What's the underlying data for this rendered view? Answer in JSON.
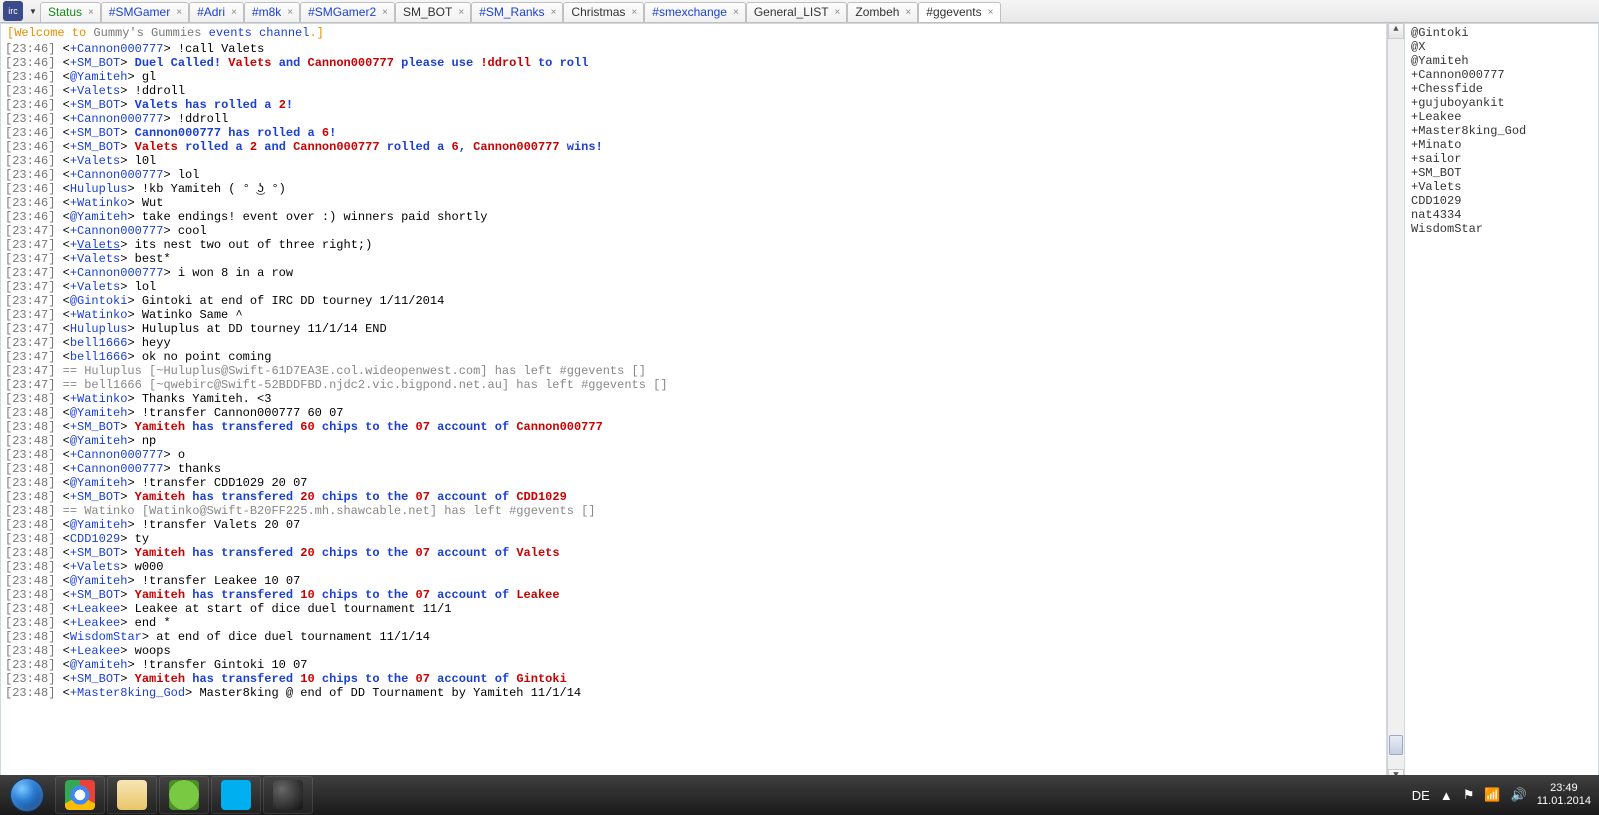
{
  "tabs": [
    {
      "label": "Status",
      "color": "green",
      "close": true
    },
    {
      "label": "#SMGamer",
      "color": "blue",
      "close": true
    },
    {
      "label": "#Adri",
      "color": "blue",
      "close": true
    },
    {
      "label": "#m8k",
      "color": "blue",
      "close": true
    },
    {
      "label": "#SMGamer2",
      "color": "blue",
      "close": true
    },
    {
      "label": "SM_BOT",
      "color": "",
      "close": true
    },
    {
      "label": "#SM_Ranks",
      "color": "blue",
      "close": true
    },
    {
      "label": "Christmas",
      "color": "",
      "close": true
    },
    {
      "label": "#smexchange",
      "color": "blue",
      "close": true
    },
    {
      "label": "General_LIST",
      "color": "",
      "close": true
    },
    {
      "label": "Zombeh",
      "color": "",
      "close": true
    },
    {
      "label": "#ggevents",
      "color": "",
      "close": true,
      "active": true
    }
  ],
  "topic": {
    "welcome": "[Welcome to ",
    "name": "Gummy's Gummies ",
    "events": "events channel",
    "end": ".]"
  },
  "chat": [
    {
      "ts": "[23:46]",
      "parts": [
        {
          "t": " <",
          "c": "txt"
        },
        {
          "t": "+Cannon000777",
          "c": "nick"
        },
        {
          "t": "> !call Valets",
          "c": "txt"
        }
      ]
    },
    {
      "ts": "[23:46]",
      "parts": [
        {
          "t": " <",
          "c": "txt"
        },
        {
          "t": "+SM_BOT",
          "c": "nick"
        },
        {
          "t": "> ",
          "c": "txt"
        },
        {
          "t": "Duel Called! ",
          "c": "blueb"
        },
        {
          "t": "Valets",
          "c": "redb"
        },
        {
          "t": " and ",
          "c": "blueb"
        },
        {
          "t": "Cannon000777",
          "c": "redb"
        },
        {
          "t": " please use ",
          "c": "blueb"
        },
        {
          "t": "!ddroll",
          "c": "redb"
        },
        {
          "t": " to roll",
          "c": "blueb"
        }
      ]
    },
    {
      "ts": "[23:46]",
      "parts": [
        {
          "t": " <",
          "c": "txt"
        },
        {
          "t": "@Yamiteh",
          "c": "nick"
        },
        {
          "t": "> gl",
          "c": "txt"
        }
      ]
    },
    {
      "ts": "[23:46]",
      "parts": [
        {
          "t": " <",
          "c": "txt"
        },
        {
          "t": "+Valets",
          "c": "nick"
        },
        {
          "t": "> !ddroll",
          "c": "txt"
        }
      ]
    },
    {
      "ts": "[23:46]",
      "parts": [
        {
          "t": " <",
          "c": "txt"
        },
        {
          "t": "+SM_BOT",
          "c": "nick"
        },
        {
          "t": "> ",
          "c": "txt"
        },
        {
          "t": "Valets has rolled a ",
          "c": "blueb"
        },
        {
          "t": "2",
          "c": "redb"
        },
        {
          "t": "!",
          "c": "blueb"
        }
      ]
    },
    {
      "ts": "[23:46]",
      "parts": [
        {
          "t": " <",
          "c": "txt"
        },
        {
          "t": "+Cannon000777",
          "c": "nick"
        },
        {
          "t": "> !ddroll",
          "c": "txt"
        }
      ]
    },
    {
      "ts": "[23:46]",
      "parts": [
        {
          "t": " <",
          "c": "txt"
        },
        {
          "t": "+SM_BOT",
          "c": "nick"
        },
        {
          "t": "> ",
          "c": "txt"
        },
        {
          "t": "Cannon000777 has rolled a ",
          "c": "blueb"
        },
        {
          "t": "6",
          "c": "redb"
        },
        {
          "t": "!",
          "c": "blueb"
        }
      ]
    },
    {
      "ts": "[23:46]",
      "parts": [
        {
          "t": " <",
          "c": "txt"
        },
        {
          "t": "+SM_BOT",
          "c": "nick"
        },
        {
          "t": "> ",
          "c": "txt"
        },
        {
          "t": "Valets",
          "c": "redb"
        },
        {
          "t": " rolled a ",
          "c": "blueb"
        },
        {
          "t": "2",
          "c": "redb"
        },
        {
          "t": " and ",
          "c": "blueb"
        },
        {
          "t": "Cannon000777",
          "c": "redb"
        },
        {
          "t": " rolled a ",
          "c": "blueb"
        },
        {
          "t": "6",
          "c": "redb"
        },
        {
          "t": ", ",
          "c": "blueb"
        },
        {
          "t": "Cannon000777",
          "c": "redb"
        },
        {
          "t": " wins!",
          "c": "blueb"
        }
      ]
    },
    {
      "ts": "[23:46]",
      "parts": [
        {
          "t": " <",
          "c": "txt"
        },
        {
          "t": "+Valets",
          "c": "nick"
        },
        {
          "t": "> l0l",
          "c": "txt"
        }
      ]
    },
    {
      "ts": "[23:46]",
      "parts": [
        {
          "t": " <",
          "c": "txt"
        },
        {
          "t": "+Cannon000777",
          "c": "nick"
        },
        {
          "t": "> lol",
          "c": "txt"
        }
      ]
    },
    {
      "ts": "[23:46]",
      "parts": [
        {
          "t": " <",
          "c": "txt"
        },
        {
          "t": "Huluplus",
          "c": "nick"
        },
        {
          "t": "> !kb Yamiteh ( ° ͜ʖ °)",
          "c": "txt"
        }
      ]
    },
    {
      "ts": "[23:46]",
      "parts": [
        {
          "t": " <",
          "c": "txt"
        },
        {
          "t": "+Watinko",
          "c": "nick"
        },
        {
          "t": "> Wut",
          "c": "txt"
        }
      ]
    },
    {
      "ts": "[23:46]",
      "parts": [
        {
          "t": " <",
          "c": "txt"
        },
        {
          "t": "@Yamiteh",
          "c": "nick"
        },
        {
          "t": "> take endings! event over :) winners paid shortly",
          "c": "txt"
        }
      ]
    },
    {
      "ts": "[23:47]",
      "parts": [
        {
          "t": " <",
          "c": "txt"
        },
        {
          "t": "+Cannon000777",
          "c": "nick"
        },
        {
          "t": "> cool",
          "c": "txt"
        }
      ]
    },
    {
      "ts": "[23:47]",
      "parts": [
        {
          "t": " <",
          "c": "txt"
        },
        {
          "t": "+",
          "c": "nick"
        },
        {
          "t": "Valets",
          "c": "nick und"
        },
        {
          "t": "> its nest two out of three right;)",
          "c": "txt"
        }
      ]
    },
    {
      "ts": "[23:47]",
      "parts": [
        {
          "t": " <",
          "c": "txt"
        },
        {
          "t": "+Valets",
          "c": "nick"
        },
        {
          "t": "> best*",
          "c": "txt"
        }
      ]
    },
    {
      "ts": "[23:47]",
      "parts": [
        {
          "t": " <",
          "c": "txt"
        },
        {
          "t": "+Cannon000777",
          "c": "nick"
        },
        {
          "t": "> i won 8 in a row",
          "c": "txt"
        }
      ]
    },
    {
      "ts": "[23:47]",
      "parts": [
        {
          "t": " <",
          "c": "txt"
        },
        {
          "t": "+Valets",
          "c": "nick"
        },
        {
          "t": "> lol",
          "c": "txt"
        }
      ]
    },
    {
      "ts": "[23:47]",
      "parts": [
        {
          "t": " <",
          "c": "txt"
        },
        {
          "t": "@Gintoki",
          "c": "nick"
        },
        {
          "t": "> Gintoki at end of IRC DD tourney 1/11/2014",
          "c": "txt"
        }
      ]
    },
    {
      "ts": "[23:47]",
      "parts": [
        {
          "t": " <",
          "c": "txt"
        },
        {
          "t": "+Watinko",
          "c": "nick"
        },
        {
          "t": "> Watinko Same ^",
          "c": "txt"
        }
      ]
    },
    {
      "ts": "[23:47]",
      "parts": [
        {
          "t": " <",
          "c": "txt"
        },
        {
          "t": "Huluplus",
          "c": "nick"
        },
        {
          "t": "> Huluplus at DD tourney 11/1/14 END",
          "c": "txt"
        }
      ]
    },
    {
      "ts": "[23:47]",
      "parts": [
        {
          "t": " <",
          "c": "txt"
        },
        {
          "t": "bell1666",
          "c": "nick"
        },
        {
          "t": "> heyy",
          "c": "txt"
        }
      ]
    },
    {
      "ts": "[23:47]",
      "parts": [
        {
          "t": " <",
          "c": "txt"
        },
        {
          "t": "bell1666",
          "c": "nick"
        },
        {
          "t": "> ok no point coming",
          "c": "txt"
        }
      ]
    },
    {
      "ts": "[23:47]",
      "parts": [
        {
          "t": " == Huluplus [~Huluplus@Swift-61D7EA3E.col.wideopenwest.com] has left #ggevents []",
          "c": "sys"
        }
      ]
    },
    {
      "ts": "[23:47]",
      "parts": [
        {
          "t": " == bell1666 [~qwebirc@Swift-52BDDFBD.njdc2.vic.bigpond.net.au] has left #ggevents []",
          "c": "sys"
        }
      ]
    },
    {
      "ts": "[23:48]",
      "parts": [
        {
          "t": " <",
          "c": "txt"
        },
        {
          "t": "+Watinko",
          "c": "nick"
        },
        {
          "t": "> Thanks Yamiteh. <3",
          "c": "txt"
        }
      ]
    },
    {
      "ts": "[23:48]",
      "parts": [
        {
          "t": " <",
          "c": "txt"
        },
        {
          "t": "@Yamiteh",
          "c": "nick"
        },
        {
          "t": "> !transfer Cannon000777 60 07",
          "c": "txt"
        }
      ]
    },
    {
      "ts": "[23:48]",
      "parts": [
        {
          "t": " <",
          "c": "txt"
        },
        {
          "t": "+SM_BOT",
          "c": "nick"
        },
        {
          "t": "> ",
          "c": "txt"
        },
        {
          "t": "Yamiteh",
          "c": "redb"
        },
        {
          "t": " has transfered ",
          "c": "blueb"
        },
        {
          "t": "60",
          "c": "redb"
        },
        {
          "t": " chips to the ",
          "c": "blueb"
        },
        {
          "t": "07",
          "c": "redb"
        },
        {
          "t": " account of ",
          "c": "blueb"
        },
        {
          "t": "Cannon000777",
          "c": "redb"
        }
      ]
    },
    {
      "ts": "[23:48]",
      "parts": [
        {
          "t": " <",
          "c": "txt"
        },
        {
          "t": "@Yamiteh",
          "c": "nick"
        },
        {
          "t": "> np",
          "c": "txt"
        }
      ]
    },
    {
      "ts": "[23:48]",
      "parts": [
        {
          "t": " <",
          "c": "txt"
        },
        {
          "t": "+Cannon000777",
          "c": "nick"
        },
        {
          "t": "> o",
          "c": "txt"
        }
      ]
    },
    {
      "ts": "[23:48]",
      "parts": [
        {
          "t": " <",
          "c": "txt"
        },
        {
          "t": "+Cannon000777",
          "c": "nick"
        },
        {
          "t": "> thanks",
          "c": "txt"
        }
      ]
    },
    {
      "ts": "[23:48]",
      "parts": [
        {
          "t": " <",
          "c": "txt"
        },
        {
          "t": "@Yamiteh",
          "c": "nick"
        },
        {
          "t": "> !transfer CDD1029 20 07",
          "c": "txt"
        }
      ]
    },
    {
      "ts": "[23:48]",
      "parts": [
        {
          "t": " <",
          "c": "txt"
        },
        {
          "t": "+SM_BOT",
          "c": "nick"
        },
        {
          "t": "> ",
          "c": "txt"
        },
        {
          "t": "Yamiteh",
          "c": "redb"
        },
        {
          "t": " has transfered ",
          "c": "blueb"
        },
        {
          "t": "20",
          "c": "redb"
        },
        {
          "t": " chips to the ",
          "c": "blueb"
        },
        {
          "t": "07",
          "c": "redb"
        },
        {
          "t": " account of ",
          "c": "blueb"
        },
        {
          "t": "CDD1029",
          "c": "redb"
        }
      ]
    },
    {
      "ts": "[23:48]",
      "parts": [
        {
          "t": " == Watinko [Watinko@Swift-B20FF225.mh.shawcable.net] has left #ggevents []",
          "c": "sys"
        }
      ]
    },
    {
      "ts": "[23:48]",
      "parts": [
        {
          "t": " <",
          "c": "txt"
        },
        {
          "t": "@Yamiteh",
          "c": "nick"
        },
        {
          "t": "> !transfer Valets 20 07",
          "c": "txt"
        }
      ]
    },
    {
      "ts": "[23:48]",
      "parts": [
        {
          "t": " <",
          "c": "txt"
        },
        {
          "t": "CDD1029",
          "c": "nick"
        },
        {
          "t": "> ty",
          "c": "txt"
        }
      ]
    },
    {
      "ts": "[23:48]",
      "parts": [
        {
          "t": " <",
          "c": "txt"
        },
        {
          "t": "+SM_BOT",
          "c": "nick"
        },
        {
          "t": "> ",
          "c": "txt"
        },
        {
          "t": "Yamiteh",
          "c": "redb"
        },
        {
          "t": " has transfered ",
          "c": "blueb"
        },
        {
          "t": "20",
          "c": "redb"
        },
        {
          "t": " chips to the ",
          "c": "blueb"
        },
        {
          "t": "07",
          "c": "redb"
        },
        {
          "t": " account of ",
          "c": "blueb"
        },
        {
          "t": "Valets",
          "c": "redb"
        }
      ]
    },
    {
      "ts": "[23:48]",
      "parts": [
        {
          "t": " <",
          "c": "txt"
        },
        {
          "t": "+Valets",
          "c": "nick"
        },
        {
          "t": "> w000",
          "c": "txt"
        }
      ]
    },
    {
      "ts": "[23:48]",
      "parts": [
        {
          "t": " <",
          "c": "txt"
        },
        {
          "t": "@Yamiteh",
          "c": "nick"
        },
        {
          "t": "> !transfer Leakee 10 07",
          "c": "txt"
        }
      ]
    },
    {
      "ts": "[23:48]",
      "parts": [
        {
          "t": " <",
          "c": "txt"
        },
        {
          "t": "+SM_BOT",
          "c": "nick"
        },
        {
          "t": "> ",
          "c": "txt"
        },
        {
          "t": "Yamiteh",
          "c": "redb"
        },
        {
          "t": " has transfered ",
          "c": "blueb"
        },
        {
          "t": "10",
          "c": "redb"
        },
        {
          "t": " chips to the ",
          "c": "blueb"
        },
        {
          "t": "07",
          "c": "redb"
        },
        {
          "t": " account of ",
          "c": "blueb"
        },
        {
          "t": "Leakee",
          "c": "redb"
        }
      ]
    },
    {
      "ts": "[23:48]",
      "parts": [
        {
          "t": " <",
          "c": "txt"
        },
        {
          "t": "+Leakee",
          "c": "nick"
        },
        {
          "t": "> Leakee at start of dice duel tournament 11/1",
          "c": "txt"
        }
      ]
    },
    {
      "ts": "[23:48]",
      "parts": [
        {
          "t": " <",
          "c": "txt"
        },
        {
          "t": "+Leakee",
          "c": "nick"
        },
        {
          "t": "> end *",
          "c": "txt"
        }
      ]
    },
    {
      "ts": "[23:48]",
      "parts": [
        {
          "t": " <",
          "c": "txt"
        },
        {
          "t": "WisdomStar",
          "c": "nick"
        },
        {
          "t": "> at end of dice duel tournament 11/1/14",
          "c": "txt"
        }
      ]
    },
    {
      "ts": "[23:48]",
      "parts": [
        {
          "t": " <",
          "c": "txt"
        },
        {
          "t": "+Leakee",
          "c": "nick"
        },
        {
          "t": "> woops",
          "c": "txt"
        }
      ]
    },
    {
      "ts": "[23:48]",
      "parts": [
        {
          "t": " <",
          "c": "txt"
        },
        {
          "t": "@Yamiteh",
          "c": "nick"
        },
        {
          "t": "> !transfer Gintoki 10 07",
          "c": "txt"
        }
      ]
    },
    {
      "ts": "[23:48]",
      "parts": [
        {
          "t": " <",
          "c": "txt"
        },
        {
          "t": "+SM_BOT",
          "c": "nick"
        },
        {
          "t": "> ",
          "c": "txt"
        },
        {
          "t": "Yamiteh",
          "c": "redb"
        },
        {
          "t": " has transfered ",
          "c": "blueb"
        },
        {
          "t": "10",
          "c": "redb"
        },
        {
          "t": " chips to the ",
          "c": "blueb"
        },
        {
          "t": "07",
          "c": "redb"
        },
        {
          "t": " account of ",
          "c": "blueb"
        },
        {
          "t": "Gintoki",
          "c": "redb"
        }
      ]
    },
    {
      "ts": "[23:48]",
      "parts": [
        {
          "t": " <",
          "c": "txt"
        },
        {
          "t": "+Master8king_God",
          "c": "nick"
        },
        {
          "t": "> Master8king @ end of DD Tournament by Yamiteh 11/1/14",
          "c": "txt"
        }
      ]
    }
  ],
  "nicklist": [
    "@Gintoki",
    "@X",
    "@Yamiteh",
    "+Cannon000777",
    "+Chessfide",
    "+gujuboyankit",
    "+Leakee",
    "+Master8king_God",
    "+Minato",
    "+sailor",
    "+SM_BOT",
    "+Valets",
    "CDD1029",
    "nat4334",
    "WisdomStar"
  ],
  "tray": {
    "lang": "DE",
    "time": "23:49",
    "date": "11.01.2014"
  }
}
